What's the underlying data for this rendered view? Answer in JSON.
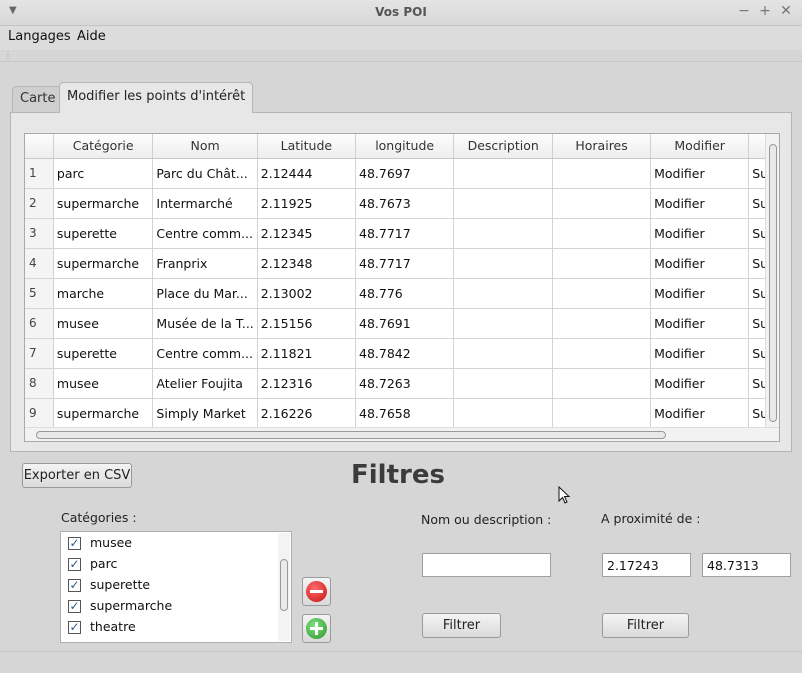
{
  "window": {
    "title": "Vos POI"
  },
  "menu": {
    "items": [
      "Langages",
      "Aide"
    ]
  },
  "tabs": [
    {
      "label": "Carte",
      "active": false
    },
    {
      "label": "Modifier les points d'intérêt",
      "active": true
    }
  ],
  "table": {
    "columns": [
      "Catégorie",
      "Nom",
      "Latitude",
      "longitude",
      "Description",
      "Horaires",
      "Modifier"
    ],
    "rows": [
      {
        "num": "1",
        "cells": [
          "parc",
          "Parc du Chât...",
          "2.12444",
          "48.7697",
          "",
          "",
          "Modifier",
          "Su"
        ]
      },
      {
        "num": "2",
        "cells": [
          "supermarche",
          "Intermarché",
          "2.11925",
          "48.7673",
          "",
          "",
          "Modifier",
          "Su"
        ]
      },
      {
        "num": "3",
        "cells": [
          "superette",
          "Centre comm...",
          "2.12345",
          "48.7717",
          "",
          "",
          "Modifier",
          "Su"
        ]
      },
      {
        "num": "4",
        "cells": [
          "supermarche",
          "Franprix",
          "2.12348",
          "48.7717",
          "",
          "",
          "Modifier",
          "Su"
        ]
      },
      {
        "num": "5",
        "cells": [
          "marche",
          "Place du Mar...",
          "2.13002",
          "48.776",
          "",
          "",
          "Modifier",
          "Su"
        ]
      },
      {
        "num": "6",
        "cells": [
          "musee",
          "Musée de la T...",
          "2.15156",
          "48.7691",
          "",
          "",
          "Modifier",
          "Su"
        ]
      },
      {
        "num": "7",
        "cells": [
          "superette",
          "Centre comm...",
          "2.11821",
          "48.7842",
          "",
          "",
          "Modifier",
          "Su"
        ]
      },
      {
        "num": "8",
        "cells": [
          "musee",
          "Atelier Foujita",
          "2.12316",
          "48.7263",
          "",
          "",
          "Modifier",
          "Su"
        ]
      },
      {
        "num": "9",
        "cells": [
          "supermarche",
          "Simply Market",
          "2.16226",
          "48.7658",
          "",
          "",
          "Modifier",
          "Su"
        ]
      }
    ]
  },
  "actions": {
    "export_label": "Exporter en CSV"
  },
  "filters": {
    "title": "Filtres",
    "categories_label": "Catégories :",
    "categories": [
      {
        "label": "musee",
        "checked": true
      },
      {
        "label": "parc",
        "checked": true
      },
      {
        "label": "superette",
        "checked": true
      },
      {
        "label": "supermarche",
        "checked": true
      },
      {
        "label": "theatre",
        "checked": true
      }
    ],
    "name_label": "Nom ou description :",
    "name_value": "",
    "proximity_label": "A proximité de :",
    "proximity_lat": "2.17243",
    "proximity_lon": "48.7313",
    "filter_button_label": "Filtrer"
  },
  "colors": {
    "remove": "#d01c1c",
    "add": "#3aa63a"
  }
}
